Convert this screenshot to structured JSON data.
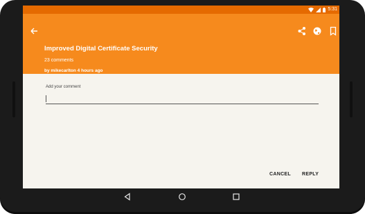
{
  "status_bar": {
    "time": "5:31"
  },
  "app_bar": {
    "back_icon": "arrow-back-icon",
    "actions": [
      "share-icon",
      "globe-icon",
      "bookmark-icon"
    ]
  },
  "post": {
    "title": "Improved Digital Certificate Security",
    "comments": "23 comments",
    "byline": "by mikecarlton 4 hours ago"
  },
  "comment_form": {
    "label": "Add your comment",
    "value": "",
    "cancel_label": "CANCEL",
    "reply_label": "REPLY"
  },
  "nav_bar": {
    "buttons": [
      "back-triangle-icon",
      "home-circle-icon",
      "recents-square-icon"
    ]
  },
  "colors": {
    "accent": "#f68a1d",
    "status_bar": "#e56a00",
    "background": "#f6f4ee"
  }
}
